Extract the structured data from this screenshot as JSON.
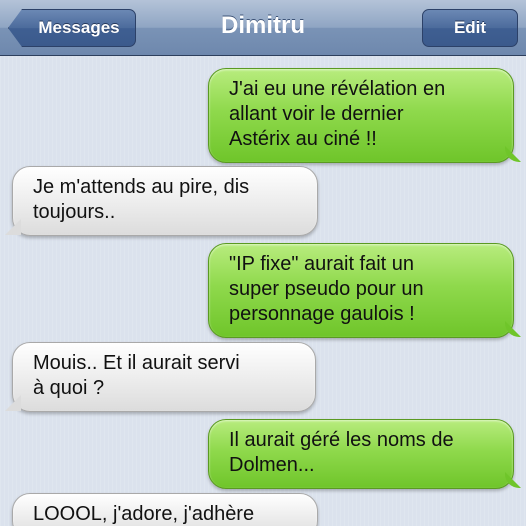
{
  "header": {
    "back_label": "Messages",
    "title": "Dimitru",
    "edit_label": "Edit"
  },
  "messages": [
    {
      "from": "me",
      "lines": [
        "J'ai eu une révélation en",
        "allant voir le dernier",
        "Astérix au ciné !!"
      ]
    },
    {
      "from": "them",
      "lines": [
        "Je m'attends au pire, dis",
        "toujours.."
      ]
    },
    {
      "from": "me",
      "lines": [
        "\"IP fixe\" aurait fait un",
        "super pseudo pour un",
        "personnage gaulois !"
      ]
    },
    {
      "from": "them",
      "lines": [
        "Mouis.. Et il aurait servi",
        "à quoi ?"
      ]
    },
    {
      "from": "me",
      "lines": [
        "Il aurait géré les noms de",
        "Dolmen..."
      ]
    },
    {
      "from": "them",
      "lines": [
        "LOOOL, j'adore, j'adhère"
      ]
    }
  ],
  "colors": {
    "sent_bubble": "#8fd94c",
    "received_bubble": "#ececec",
    "navbar": "#7a93b6"
  }
}
